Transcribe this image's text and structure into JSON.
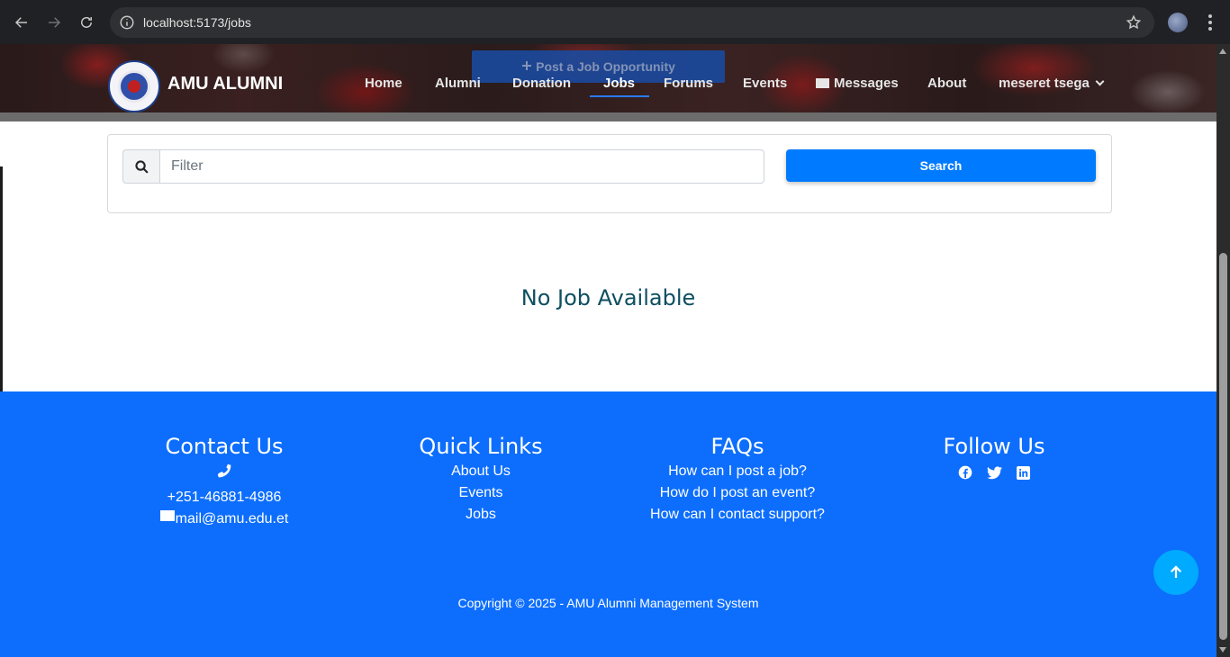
{
  "browser": {
    "url": "localhost:5173/jobs"
  },
  "header": {
    "brand": "AMU ALUMNI",
    "post_job_label": "Post a Job Opportunity",
    "nav": {
      "home": "Home",
      "alumni": "Alumni",
      "donation": "Donation",
      "jobs": "Jobs",
      "forums": "Forums",
      "events": "Events",
      "messages": "Messages",
      "about": "About",
      "user": "meseret tsega"
    },
    "active_nav": "Jobs"
  },
  "search": {
    "placeholder": "Filter",
    "button_label": "Search"
  },
  "main": {
    "empty_message": "No Job Available"
  },
  "footer": {
    "contact": {
      "title": "Contact Us",
      "phone": "+251-46881-4986",
      "email": "mail@amu.edu.et"
    },
    "quick_links": {
      "title": "Quick Links",
      "items": [
        "About Us",
        "Events",
        "Jobs"
      ]
    },
    "faqs": {
      "title": "FAQs",
      "items": [
        "How can I post a job?",
        "How do I post an event?",
        "How can I contact support?"
      ]
    },
    "follow": {
      "title": "Follow Us",
      "icons": [
        "facebook-icon",
        "twitter-icon",
        "linkedin-icon"
      ]
    },
    "copyright": "Copyright © 2025 - AMU Alumni Management System"
  },
  "colors": {
    "primary": "#007bff",
    "footer_bg": "#0d6efd",
    "empty_text": "#0d4f60",
    "back_to_top": "#00aaff"
  }
}
